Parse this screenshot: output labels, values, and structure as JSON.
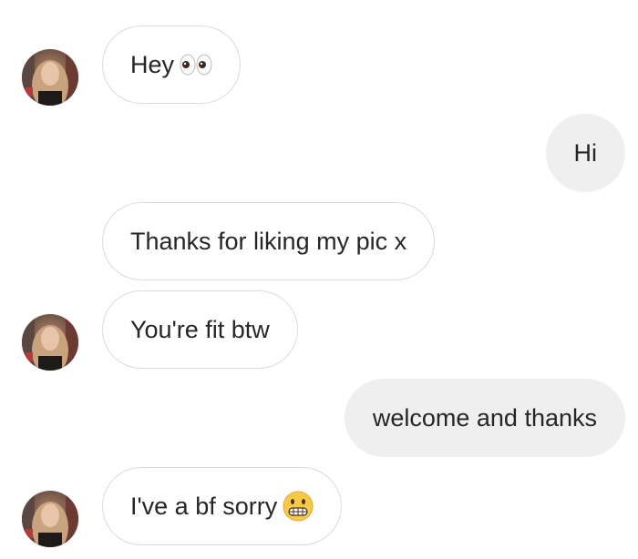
{
  "thread": {
    "messages": [
      {
        "direction": "incoming",
        "text": "Hey",
        "emoji": "eyes-emoji",
        "avatar": true
      },
      {
        "direction": "outgoing",
        "text": "Hi"
      },
      {
        "direction": "incoming",
        "text": "Thanks for liking my pic x",
        "avatar": false
      },
      {
        "direction": "incoming",
        "text": "You're fit btw",
        "avatar": true
      },
      {
        "direction": "outgoing",
        "text": "welcome and thanks"
      },
      {
        "direction": "incoming",
        "text": "I've a bf sorry",
        "emoji": "grimacing-face-emoji",
        "avatar": true
      }
    ]
  },
  "colors": {
    "incoming_bg": "#ffffff",
    "incoming_border": "#dbdbdb",
    "outgoing_bg": "#efefef",
    "text": "#262626"
  }
}
